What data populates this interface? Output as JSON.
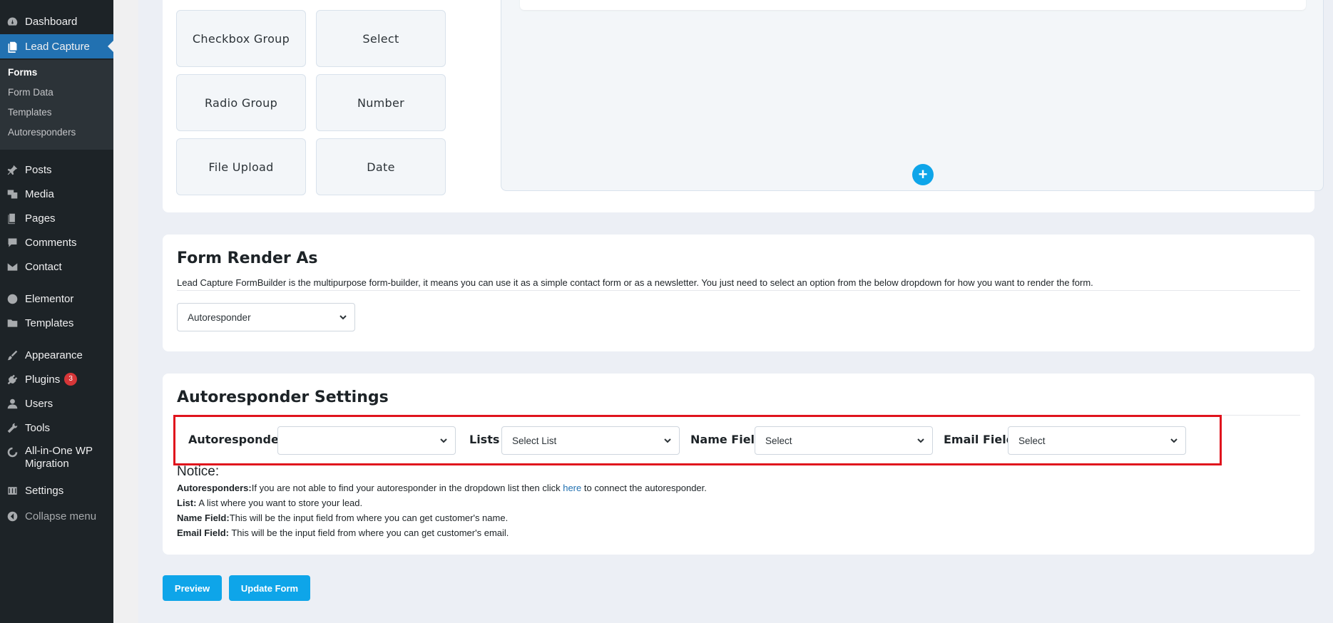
{
  "sidebar": {
    "dashboard": "Dashboard",
    "lead_capture": "Lead Capture",
    "sub": [
      "Forms",
      "Form Data",
      "Templates",
      "Autoresponders"
    ],
    "posts": "Posts",
    "media": "Media",
    "pages": "Pages",
    "comments": "Comments",
    "contact": "Contact",
    "elementor": "Elementor",
    "templates": "Templates",
    "appearance": "Appearance",
    "plugins": "Plugins",
    "plugins_badge": "3",
    "users": "Users",
    "tools": "Tools",
    "migration_line1": "All-in-One WP",
    "migration_line2": "Migration",
    "settings": "Settings",
    "collapse": "Collapse menu"
  },
  "fields": {
    "checkbox_group": "Checkbox Group",
    "select": "Select",
    "radio_group": "Radio Group",
    "number": "Number",
    "file_upload": "File Upload",
    "date": "Date"
  },
  "render": {
    "title": "Form Render As",
    "description": "Lead Capture FormBuilder is the multipurpose form-builder, it means you can use it as a simple contact form or as a newsletter. You just need to select an option from the below dropdown for how you want to render the form.",
    "selected": "Autoresponder"
  },
  "autoresponder": {
    "title": "Autoresponder Settings",
    "autoresponders_label": "Autoresponders",
    "autoresponders_value": "",
    "lists_label": "Lists",
    "lists_value": "Select List",
    "name_field_label": "Name Field",
    "name_field_value": "Select",
    "email_field_label": "Email Field",
    "email_field_value": "Select"
  },
  "notice": {
    "title": "Notice:",
    "autoresponders_key": "Autoresponders:",
    "autoresponders_text1": "If you are not able to find your autoresponder in the dropdown list then click ",
    "autoresponders_link": "here",
    "autoresponders_text2": " to connect the autoresponder.",
    "list_key": "List:",
    "list_text": " A list where you want to store your lead.",
    "name_key": "Name Field:",
    "name_text": "This will be the input field from where you can get customer's name.",
    "email_key": "Email Field:",
    "email_text": " This will be the input field from where you can get customer's email."
  },
  "buttons": {
    "preview": "Preview",
    "update": "Update Form"
  },
  "colors": {
    "sidebar_bg": "#1d2327",
    "active_menu": "#2271b1",
    "accent": "#0ea5e9",
    "highlight_border": "#e0131d"
  }
}
